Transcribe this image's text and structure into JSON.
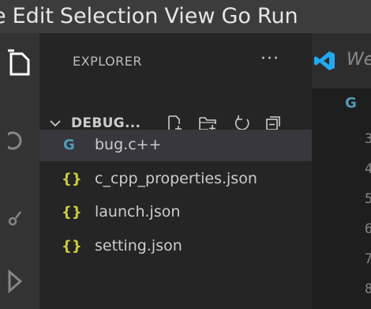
{
  "menubar": {
    "items": [
      "e",
      "Edit",
      "Selection",
      "View",
      "Go",
      "Run"
    ]
  },
  "activity_bar": {
    "icons": [
      "explorer-icon",
      "search-icon",
      "source-control-icon",
      "run-debug-icon"
    ]
  },
  "sidebar": {
    "title": "EXPLORER",
    "more_actions": "···",
    "section": {
      "title": "DEBUG...",
      "expanded": true,
      "actions": [
        "new-file-icon",
        "new-folder-icon",
        "refresh-icon",
        "collapse-all-icon"
      ]
    },
    "files": [
      {
        "name": "bug.c++",
        "icon": "cpp-file-icon",
        "icon_text": "G",
        "selected": true
      },
      {
        "name": "c_cpp_properties.json",
        "icon": "json-file-icon",
        "icon_text": "{}",
        "selected": false
      },
      {
        "name": "launch.json",
        "icon": "json-file-icon",
        "icon_text": "{}",
        "selected": false
      },
      {
        "name": "setting.json",
        "icon": "json-file-icon",
        "icon_text": "{}",
        "selected": false
      }
    ]
  },
  "editor": {
    "tab_label": "We",
    "line_numbers": [
      "3",
      "4",
      "5",
      "6",
      "7",
      "8"
    ]
  },
  "colors": {
    "menubar_bg": "#3c3c3c",
    "activity_bar_bg": "#333333",
    "sidebar_bg": "#252526",
    "selected_row_bg": "#37373d",
    "cpp_icon": "#519aba",
    "json_icon": "#cbcb41",
    "vscode_blue": "#23a9f2"
  }
}
